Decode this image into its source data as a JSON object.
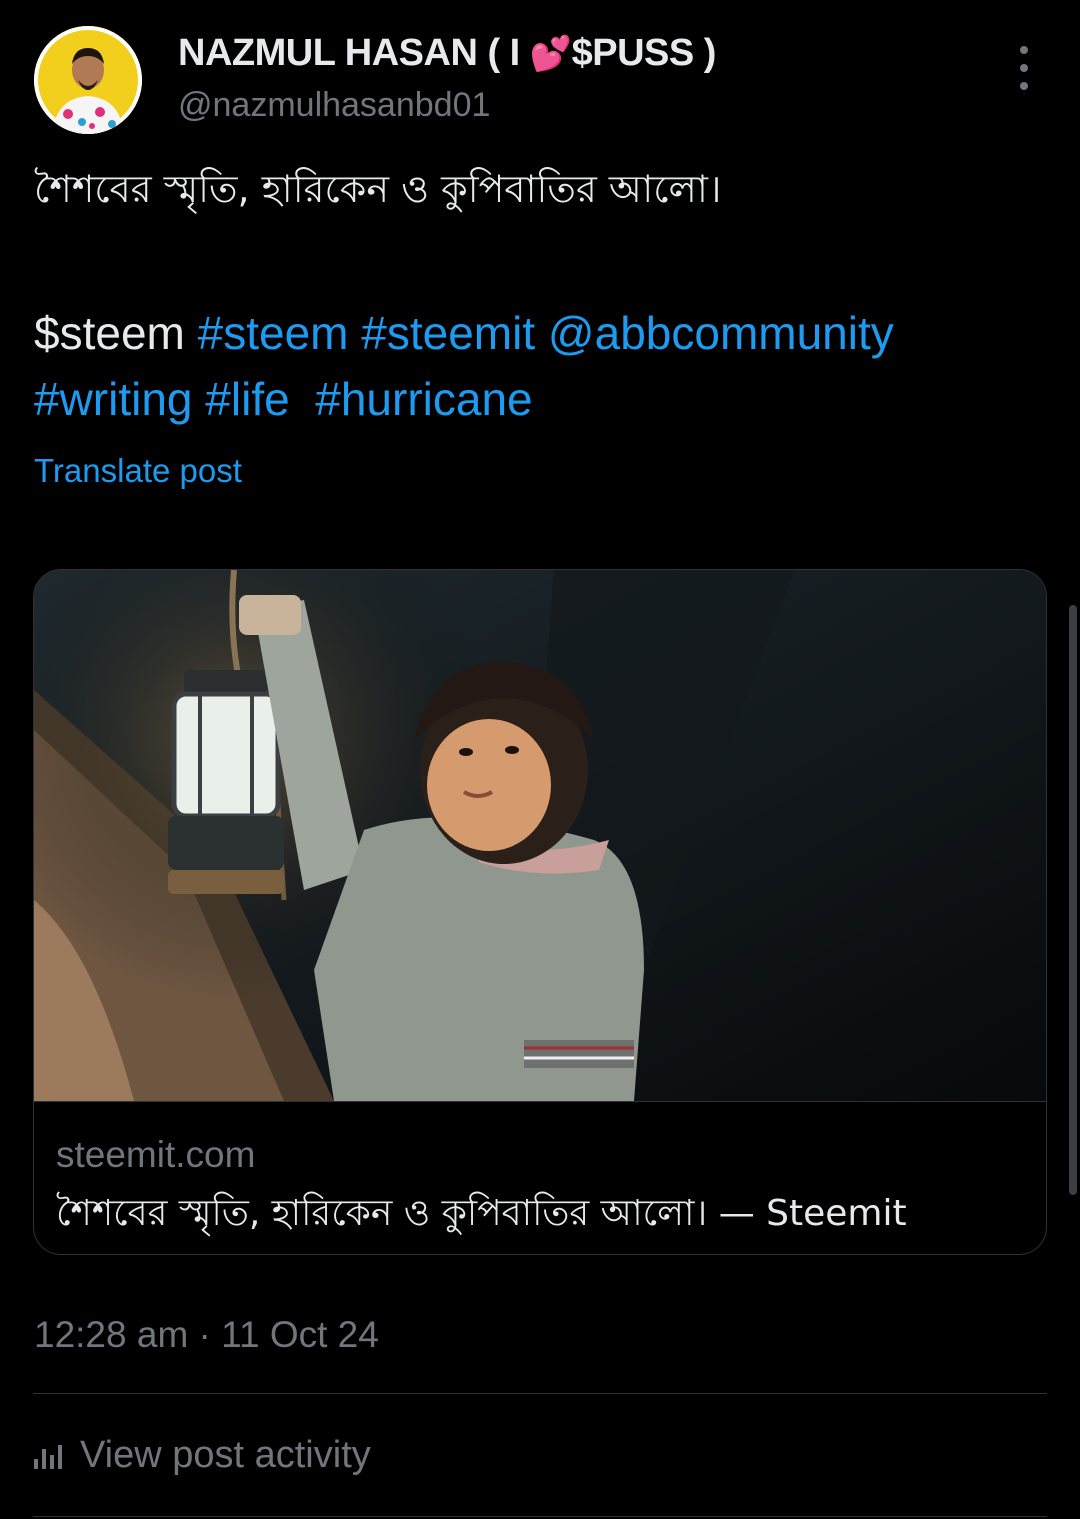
{
  "user": {
    "display_name_prefix": "NAZMUL HASAN ( I ",
    "display_name_emoji": "💕",
    "display_name_suffix": "$PUSS )",
    "handle": "@nazmulhasanbd01"
  },
  "post": {
    "text": "শৈশবের স্মৃতি, হারিকেন ও কুপিবাতির আলো।",
    "cashtag": "$steem",
    "tags_line1": [
      "#steem",
      "#steemit",
      "@abbcommunity"
    ],
    "tags_line2": [
      "#writing",
      "#life",
      "#hurricane"
    ],
    "translate_label": "Translate post"
  },
  "card": {
    "domain": "steemit.com",
    "title": "শৈশবের স্মৃতি, হারিকেন ও কুপিবাতির আলো। — Steemit"
  },
  "timestamp": "12:28 am · 11 Oct 24",
  "activity_label": "View post activity",
  "icons": {
    "more": "more-vertical-icon",
    "activity": "bar-chart-icon"
  },
  "colors": {
    "background": "#000000",
    "link": "#1d9bf0",
    "text": "#e7e9ea",
    "secondary": "#71767b",
    "border": "#2f3336"
  }
}
